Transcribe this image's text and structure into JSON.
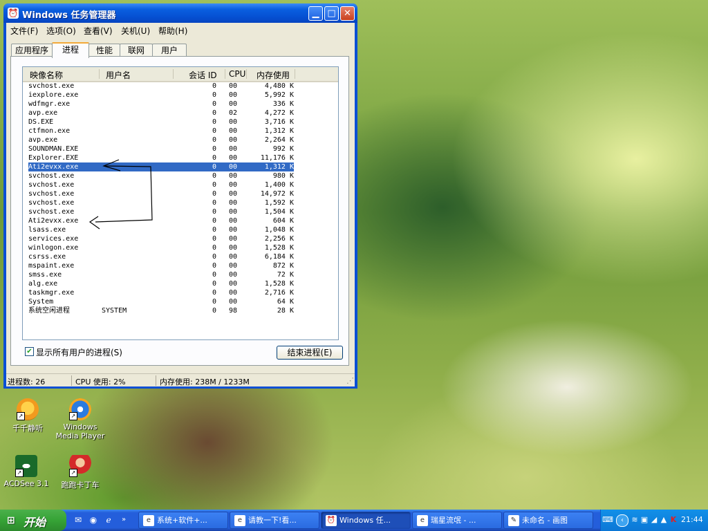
{
  "window": {
    "title": "Windows 任务管理器",
    "menu": [
      "文件(F)",
      "选项(O)",
      "查看(V)",
      "关机(U)",
      "帮助(H)"
    ],
    "tabs": [
      "应用程序",
      "进程",
      "性能",
      "联网",
      "用户"
    ],
    "active_tab": "进程",
    "columns": [
      "映像名称",
      "用户名",
      "会话 ID",
      "CPU",
      "内存使用"
    ],
    "processes": [
      {
        "name": "svchost.exe",
        "user": "",
        "session": "0",
        "cpu": "00",
        "mem": "4,480 K"
      },
      {
        "name": "iexplore.exe",
        "user": "",
        "session": "0",
        "cpu": "00",
        "mem": "5,992 K"
      },
      {
        "name": "wdfmgr.exe",
        "user": "",
        "session": "0",
        "cpu": "00",
        "mem": "336 K"
      },
      {
        "name": "avp.exe",
        "user": "",
        "session": "0",
        "cpu": "02",
        "mem": "4,272 K"
      },
      {
        "name": "DS.EXE",
        "user": "",
        "session": "0",
        "cpu": "00",
        "mem": "3,716 K"
      },
      {
        "name": "ctfmon.exe",
        "user": "",
        "session": "0",
        "cpu": "00",
        "mem": "1,312 K"
      },
      {
        "name": "avp.exe",
        "user": "",
        "session": "0",
        "cpu": "00",
        "mem": "2,264 K"
      },
      {
        "name": "SOUNDMAN.EXE",
        "user": "",
        "session": "0",
        "cpu": "00",
        "mem": "992 K"
      },
      {
        "name": "Explorer.EXE",
        "user": "",
        "session": "0",
        "cpu": "00",
        "mem": "11,176 K"
      },
      {
        "name": "Ati2evxx.exe",
        "user": "",
        "session": "0",
        "cpu": "00",
        "mem": "1,312 K",
        "selected": true
      },
      {
        "name": "svchost.exe",
        "user": "",
        "session": "0",
        "cpu": "00",
        "mem": "980 K"
      },
      {
        "name": "svchost.exe",
        "user": "",
        "session": "0",
        "cpu": "00",
        "mem": "1,400 K"
      },
      {
        "name": "svchost.exe",
        "user": "",
        "session": "0",
        "cpu": "00",
        "mem": "14,972 K"
      },
      {
        "name": "svchost.exe",
        "user": "",
        "session": "0",
        "cpu": "00",
        "mem": "1,592 K"
      },
      {
        "name": "svchost.exe",
        "user": "",
        "session": "0",
        "cpu": "00",
        "mem": "1,504 K"
      },
      {
        "name": "Ati2evxx.exe",
        "user": "",
        "session": "0",
        "cpu": "00",
        "mem": "604 K"
      },
      {
        "name": "lsass.exe",
        "user": "",
        "session": "0",
        "cpu": "00",
        "mem": "1,048 K"
      },
      {
        "name": "services.exe",
        "user": "",
        "session": "0",
        "cpu": "00",
        "mem": "2,256 K"
      },
      {
        "name": "winlogon.exe",
        "user": "",
        "session": "0",
        "cpu": "00",
        "mem": "1,528 K"
      },
      {
        "name": "csrss.exe",
        "user": "",
        "session": "0",
        "cpu": "00",
        "mem": "6,184 K"
      },
      {
        "name": "mspaint.exe",
        "user": "",
        "session": "0",
        "cpu": "00",
        "mem": "872 K"
      },
      {
        "name": "smss.exe",
        "user": "",
        "session": "0",
        "cpu": "00",
        "mem": "72 K"
      },
      {
        "name": "alg.exe",
        "user": "",
        "session": "0",
        "cpu": "00",
        "mem": "1,528 K"
      },
      {
        "name": "taskmgr.exe",
        "user": "",
        "session": "0",
        "cpu": "00",
        "mem": "2,716 K"
      },
      {
        "name": "System",
        "user": "",
        "session": "0",
        "cpu": "00",
        "mem": "64 K"
      },
      {
        "name": "系统空闲进程",
        "user": "SYSTEM",
        "session": "0",
        "cpu": "98",
        "mem": "28 K"
      }
    ],
    "show_all_label": "显示所有用户的进程(S)",
    "show_all_checked": true,
    "end_process_label": "结束进程(E)",
    "status": {
      "processes": "进程数: 26",
      "cpu": "CPU 使用: 2%",
      "memory": "内存使用: 238M / 1233M"
    }
  },
  "desktop_icons": [
    {
      "label": "千千静听"
    },
    {
      "label": "Windows Media Player"
    },
    {
      "label": "ACDSee 3.1"
    },
    {
      "label": "跑跑卡丁车"
    }
  ],
  "taskbar": {
    "start_label": "开始",
    "tasks": [
      {
        "label": "系统+软件+..."
      },
      {
        "label": "请教一下!看..."
      },
      {
        "label": "Windows 任..."
      },
      {
        "label": "瑞星流氓 - ..."
      },
      {
        "label": "未命名 - 画图"
      }
    ],
    "active_task": "Windows 任...",
    "clock": "21:44"
  },
  "colors": {
    "title_bar": "#0550d2",
    "selection": "#316ac5",
    "start_button": "#36a336",
    "taskbar": "#245edb"
  }
}
